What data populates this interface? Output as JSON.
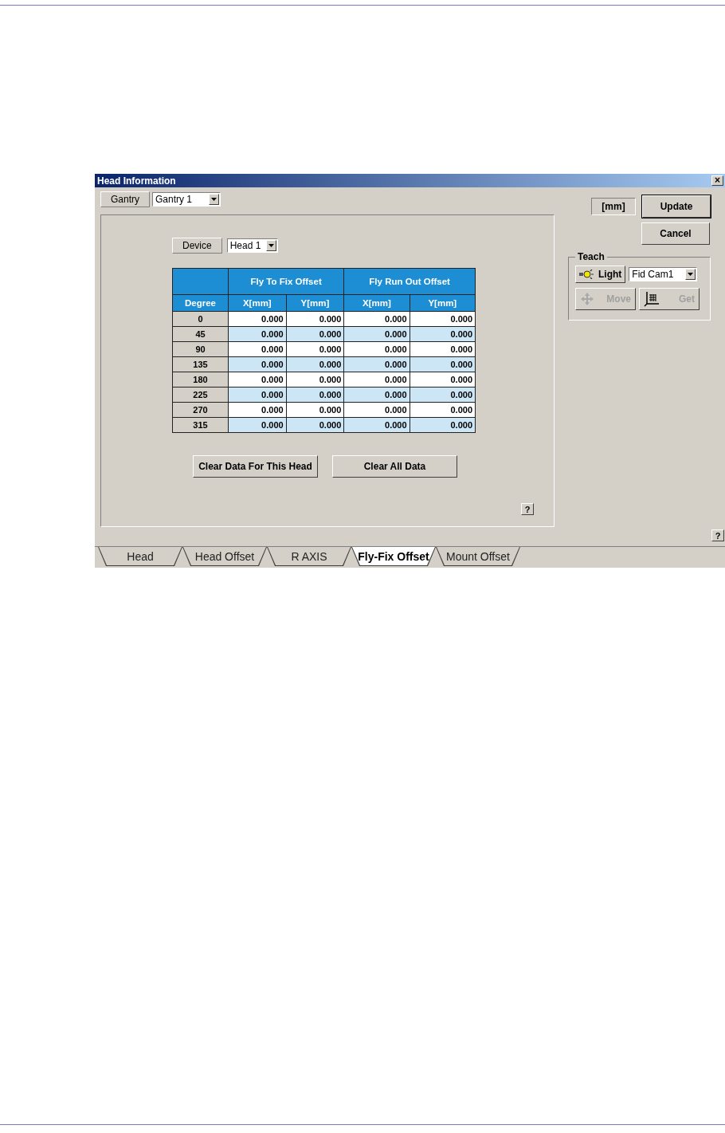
{
  "window": {
    "title": "Head Information",
    "close": "×"
  },
  "gantry": {
    "label": "Gantry",
    "value": "Gantry 1"
  },
  "device": {
    "label": "Device",
    "value": "Head 1"
  },
  "table": {
    "group_headers": [
      "Fly To Fix Offset",
      "Fly Run Out Offset"
    ],
    "columns": [
      "Degree",
      "X[mm]",
      "Y[mm]",
      "X[mm]",
      "Y[mm]"
    ],
    "rows": [
      {
        "degree": "0",
        "values": [
          "0.000",
          "0.000",
          "0.000",
          "0.000"
        ]
      },
      {
        "degree": "45",
        "values": [
          "0.000",
          "0.000",
          "0.000",
          "0.000"
        ]
      },
      {
        "degree": "90",
        "values": [
          "0.000",
          "0.000",
          "0.000",
          "0.000"
        ]
      },
      {
        "degree": "135",
        "values": [
          "0.000",
          "0.000",
          "0.000",
          "0.000"
        ]
      },
      {
        "degree": "180",
        "values": [
          "0.000",
          "0.000",
          "0.000",
          "0.000"
        ]
      },
      {
        "degree": "225",
        "values": [
          "0.000",
          "0.000",
          "0.000",
          "0.000"
        ]
      },
      {
        "degree": "270",
        "values": [
          "0.000",
          "0.000",
          "0.000",
          "0.000"
        ]
      },
      {
        "degree": "315",
        "values": [
          "0.000",
          "0.000",
          "0.000",
          "0.000"
        ]
      }
    ]
  },
  "panel_buttons": [
    "Clear Data For This Head",
    "Clear All Data"
  ],
  "panel_help": "?",
  "unit_label": "[mm]",
  "update_button": "Update",
  "cancel_button": "Cancel",
  "teach": {
    "title": "Teach",
    "camera": "Fid Cam1",
    "buttons": [
      {
        "kind": "light",
        "label": "Light",
        "disabled": false
      },
      {
        "kind": "move",
        "label": "Move",
        "disabled": true
      },
      {
        "kind": "get",
        "label": "Get",
        "disabled": true
      }
    ]
  },
  "window_help": "?",
  "tabs": [
    {
      "label": "Head",
      "selected": false
    },
    {
      "label": "Head Offset",
      "selected": false
    },
    {
      "label": "R AXIS",
      "selected": false
    },
    {
      "label": "Fly-Fix Offset",
      "selected": true
    },
    {
      "label": "Mount Offset",
      "selected": false
    }
  ]
}
